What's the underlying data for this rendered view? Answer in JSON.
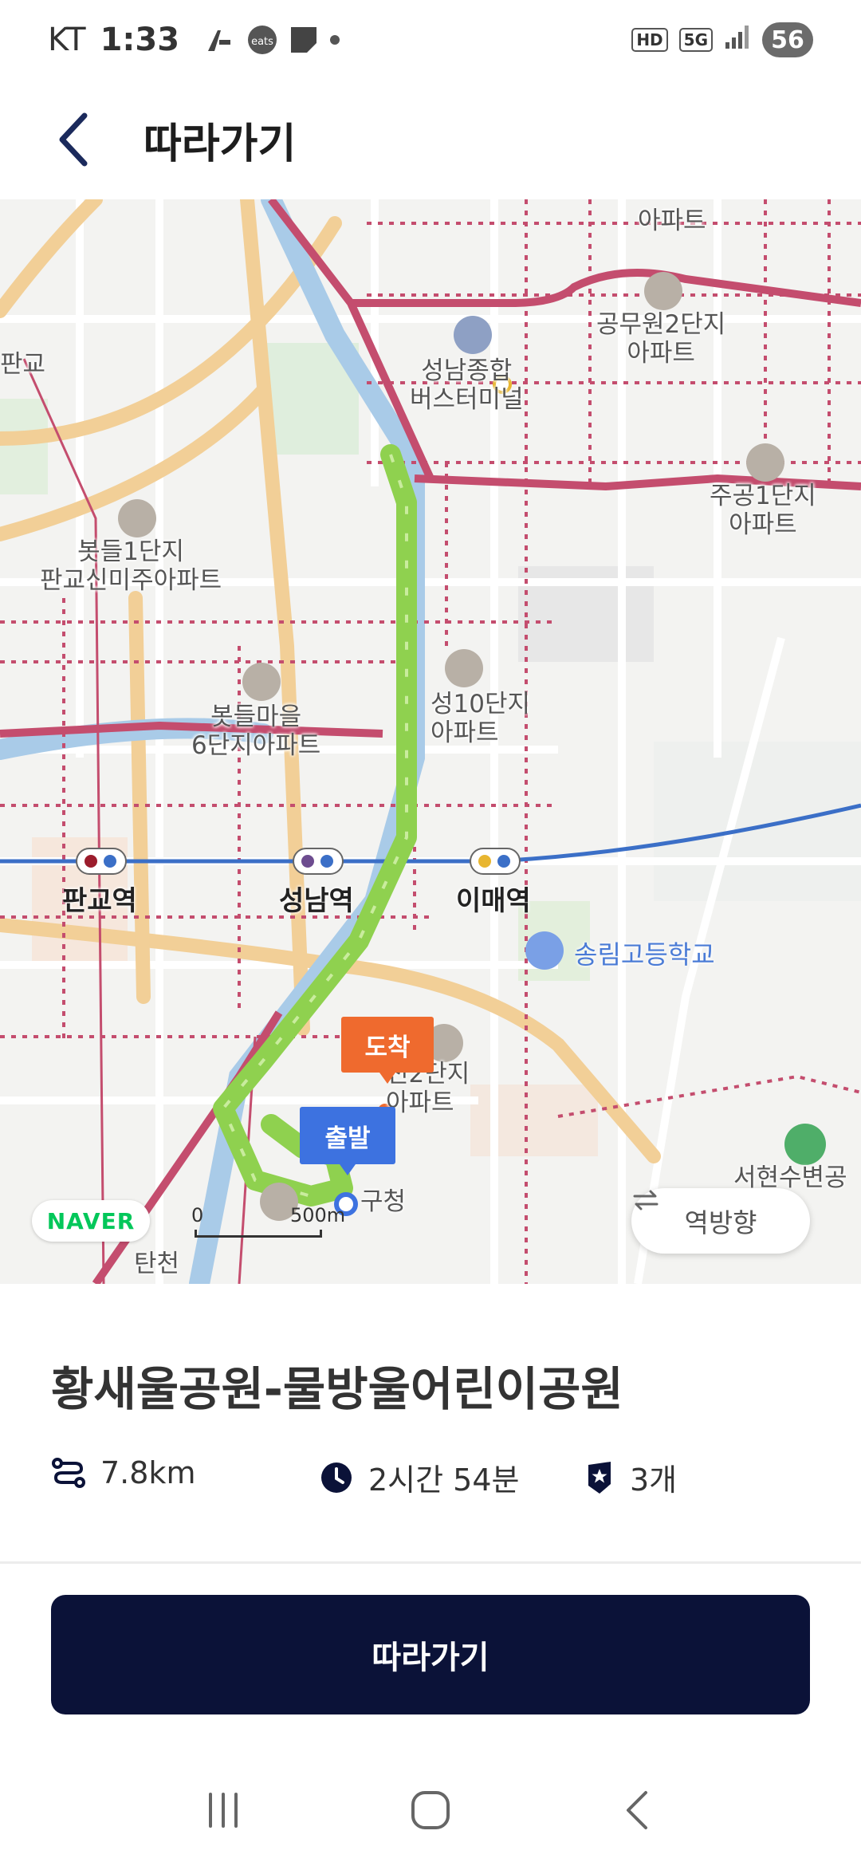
{
  "status_bar": {
    "carrier": "KT",
    "time": "1:33",
    "hd_label": "HD",
    "network_label": "5G",
    "battery": "56"
  },
  "header": {
    "title": "따라가기",
    "back_icon": "chevron-left-icon"
  },
  "map": {
    "poi": [
      {
        "text": "아파트"
      },
      {
        "text": "공무원2단지\n아파트"
      },
      {
        "text": "성남종합\n버스터미널"
      },
      {
        "text": "주공1단지\n아파트"
      },
      {
        "text": "봇들1단지\n판교신미주아파트"
      },
      {
        "text": "봇들마을\n6단지아파트"
      },
      {
        "text": "성10단지\n아파트"
      },
      {
        "text": "전2단지\n아파트"
      },
      {
        "text": "구청"
      },
      {
        "text": "탄천"
      },
      {
        "text": "판교"
      },
      {
        "text": "서현수변공"
      }
    ],
    "stations": [
      {
        "text": "판교역"
      },
      {
        "text": "성남역"
      },
      {
        "text": "이매역"
      }
    ],
    "school": "송림고등학교",
    "marker_arrive": "도착",
    "marker_depart": "출발",
    "naver_logo": "NAVER",
    "scale_zero": "0",
    "scale_distance": "500m",
    "reverse_button": "역방향",
    "route_color": "#8fd14f",
    "road_color": "#c44d6e"
  },
  "course": {
    "title": "황새울공원-물방울어린이공원",
    "distance": "7.8km",
    "duration": "2시간 54분",
    "stamps": "3개"
  },
  "actions": {
    "follow_button": "따라가기"
  },
  "nav_bar": {
    "recent_icon": "recent-apps-icon",
    "home_icon": "home-icon",
    "back_icon": "back-icon"
  }
}
